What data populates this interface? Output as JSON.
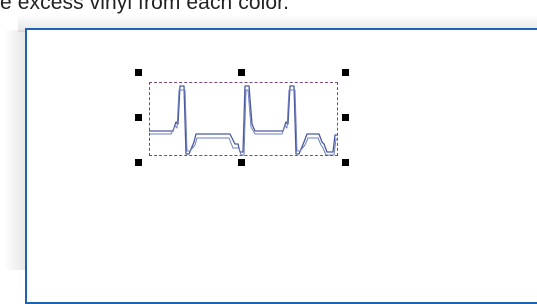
{
  "caption": {
    "text": "e excess vinyl from each color."
  },
  "canvas": {
    "border_color": "#1e62b0",
    "background": "#ffffff"
  },
  "selection": {
    "frame_color": "#7a4a7e",
    "handle_color": "#000000",
    "handle_count": 8
  },
  "artwork": {
    "icon": "heartbeat-waveform-icon",
    "outer_stroke_color": "#4a5a9e",
    "inner_stroke_color": "#6f7fbf"
  }
}
